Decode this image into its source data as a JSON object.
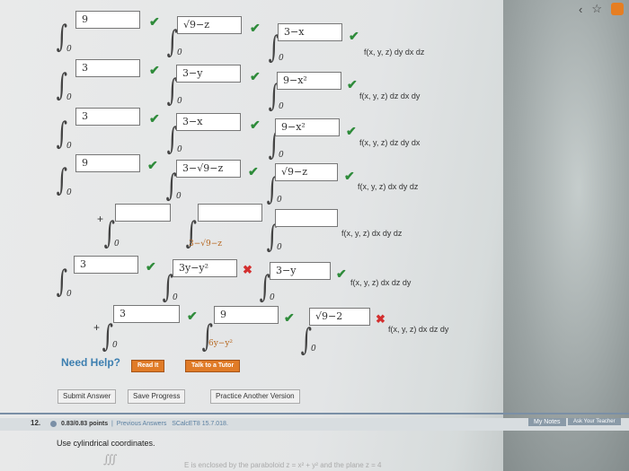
{
  "rows": [
    {
      "b1": "9",
      "b2": "√9−z",
      "b3": "3−x",
      "expr": "f(x, y, z) dy dx dz"
    },
    {
      "b1": "3",
      "b2": "3−y",
      "b3": "9−x²",
      "expr": "f(x, y, z) dz dx dy"
    },
    {
      "b1": "3",
      "b2": "3−x",
      "b3": "9−x²",
      "expr": "f(x, y, z) dz dy dx"
    },
    {
      "b1": "9",
      "b2": "3−√9−z",
      "b3": "√9−z",
      "expr": "f(x, y, z) dx dy dz"
    },
    {
      "b1": "",
      "b2": "",
      "b3": "",
      "lower": "3−√9−z",
      "expr": "f(x, y, z) dx dy dz"
    },
    {
      "b1": "3",
      "b2": "3y−y²",
      "b3": "3−y",
      "expr": "f(x, y, z) dx dz dy"
    },
    {
      "b1": "3",
      "b2": "9",
      "b3": "√9−2",
      "lower": "6y−y²",
      "expr": "f(x, y, z) dx dz dy"
    }
  ],
  "zero": "0",
  "plus": "+",
  "help": {
    "label": "Need Help?",
    "read": "Read It",
    "talk": "Talk to a Tutor"
  },
  "actions": {
    "submit": "Submit Answer",
    "save": "Save Progress",
    "practice": "Practice Another Version"
  },
  "question": {
    "number": "12.",
    "points": "0.83/0.83 points",
    "prev": "Previous Answers",
    "source": "SCalcET8 15.7.018.",
    "tab1": "My Notes",
    "tab2": "Ask Your Teacher",
    "text": "Use cylindrical coordinates.",
    "faded": "∭",
    "faded2": "E is enclosed by the paraboloid  z = x² + y²  and the plane  z = 4"
  },
  "colors": {
    "ok": "#2e8b3a",
    "bad": "#d32f2f",
    "accent": "#e07b27"
  }
}
